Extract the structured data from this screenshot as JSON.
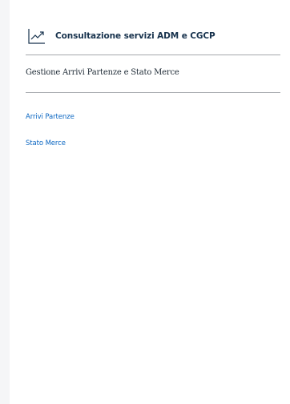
{
  "header": {
    "title": "Consultazione servizi ADM e CGCP",
    "icon": "trending-up-icon"
  },
  "section": {
    "title": "Gestione Arrivi Partenze e Stato Merce"
  },
  "nav": {
    "items": [
      {
        "label": "Arrivi Partenze"
      },
      {
        "label": "Stato Merce"
      }
    ]
  },
  "colors": {
    "title": "#17324d",
    "link": "#0a66c2",
    "divider": "#a5a8ac",
    "background": "#f5f6f7",
    "panel": "#ffffff"
  }
}
